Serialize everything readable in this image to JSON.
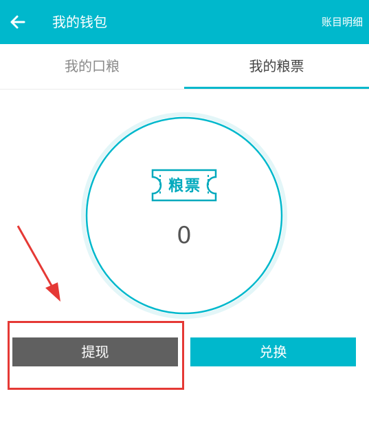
{
  "header": {
    "title": "我的钱包",
    "action_label": "账目明细",
    "back_icon": "arrow-left-icon",
    "bg_color": "#00b8cc"
  },
  "tabs": [
    {
      "label": "我的口粮",
      "active": false
    },
    {
      "label": "我的粮票",
      "active": true
    }
  ],
  "balance": {
    "ticket_label": "粮票",
    "ticket_icon": "ticket-icon",
    "value": "0"
  },
  "actions": {
    "withdraw_label": "提现",
    "exchange_label": "兑换"
  },
  "colors": {
    "accent": "#00b8cc",
    "withdraw_button": "#606060",
    "annotation": "#e53935"
  }
}
